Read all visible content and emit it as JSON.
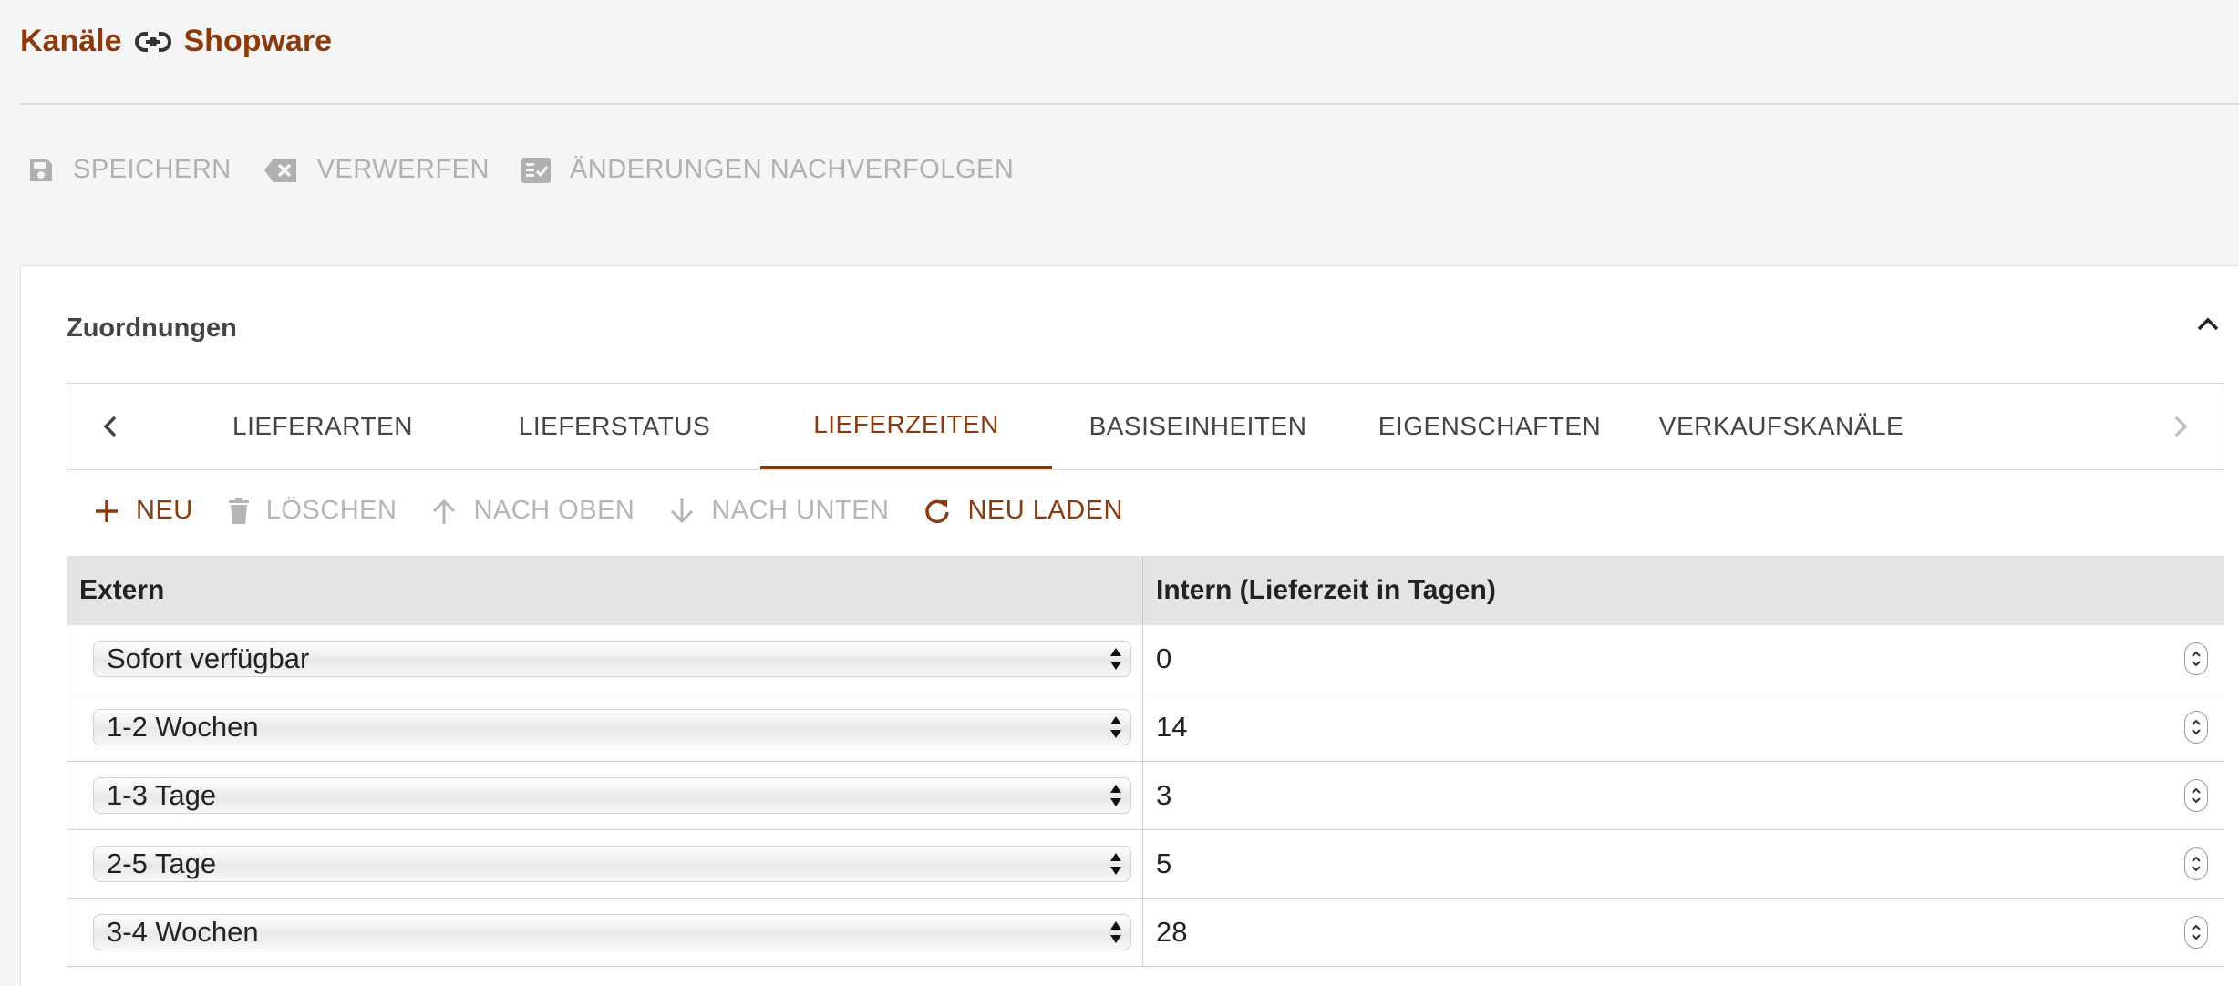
{
  "header": {
    "breadcrumb_parent": "Kanäle",
    "breadcrumb_current": "Shopware"
  },
  "toolbar": {
    "save_label": "SPEICHERN",
    "discard_label": "VERWERFEN",
    "track_changes_label": "ÄNDERUNGEN NACHVERFOLGEN"
  },
  "panel": {
    "title": "Zuordnungen"
  },
  "tabs": [
    {
      "label": "LIEFERARTEN",
      "active": false
    },
    {
      "label": "LIEFERSTATUS",
      "active": false
    },
    {
      "label": "LIEFERZEITEN",
      "active": true
    },
    {
      "label": "BASISEINHEITEN",
      "active": false
    },
    {
      "label": "EIGENSCHAFTEN",
      "active": false
    },
    {
      "label": "VERKAUFSKANÄLE",
      "active": false
    }
  ],
  "actions": {
    "new_label": "NEU",
    "delete_label": "LÖSCHEN",
    "move_up_label": "NACH OBEN",
    "move_down_label": "NACH UNTEN",
    "reload_label": "NEU LADEN"
  },
  "grid": {
    "columns": [
      "Extern",
      "Intern (Lieferzeit in Tagen)"
    ],
    "rows": [
      {
        "extern": "Sofort verfügbar",
        "intern": "0"
      },
      {
        "extern": "1-2 Wochen",
        "intern": "14"
      },
      {
        "extern": "1-3 Tage",
        "intern": "3"
      },
      {
        "extern": "2-5 Tage",
        "intern": "5"
      },
      {
        "extern": "3-4 Wochen",
        "intern": "28"
      }
    ]
  },
  "colors": {
    "accent": "#8a3a0c",
    "disabled": "#b0b0b0"
  }
}
